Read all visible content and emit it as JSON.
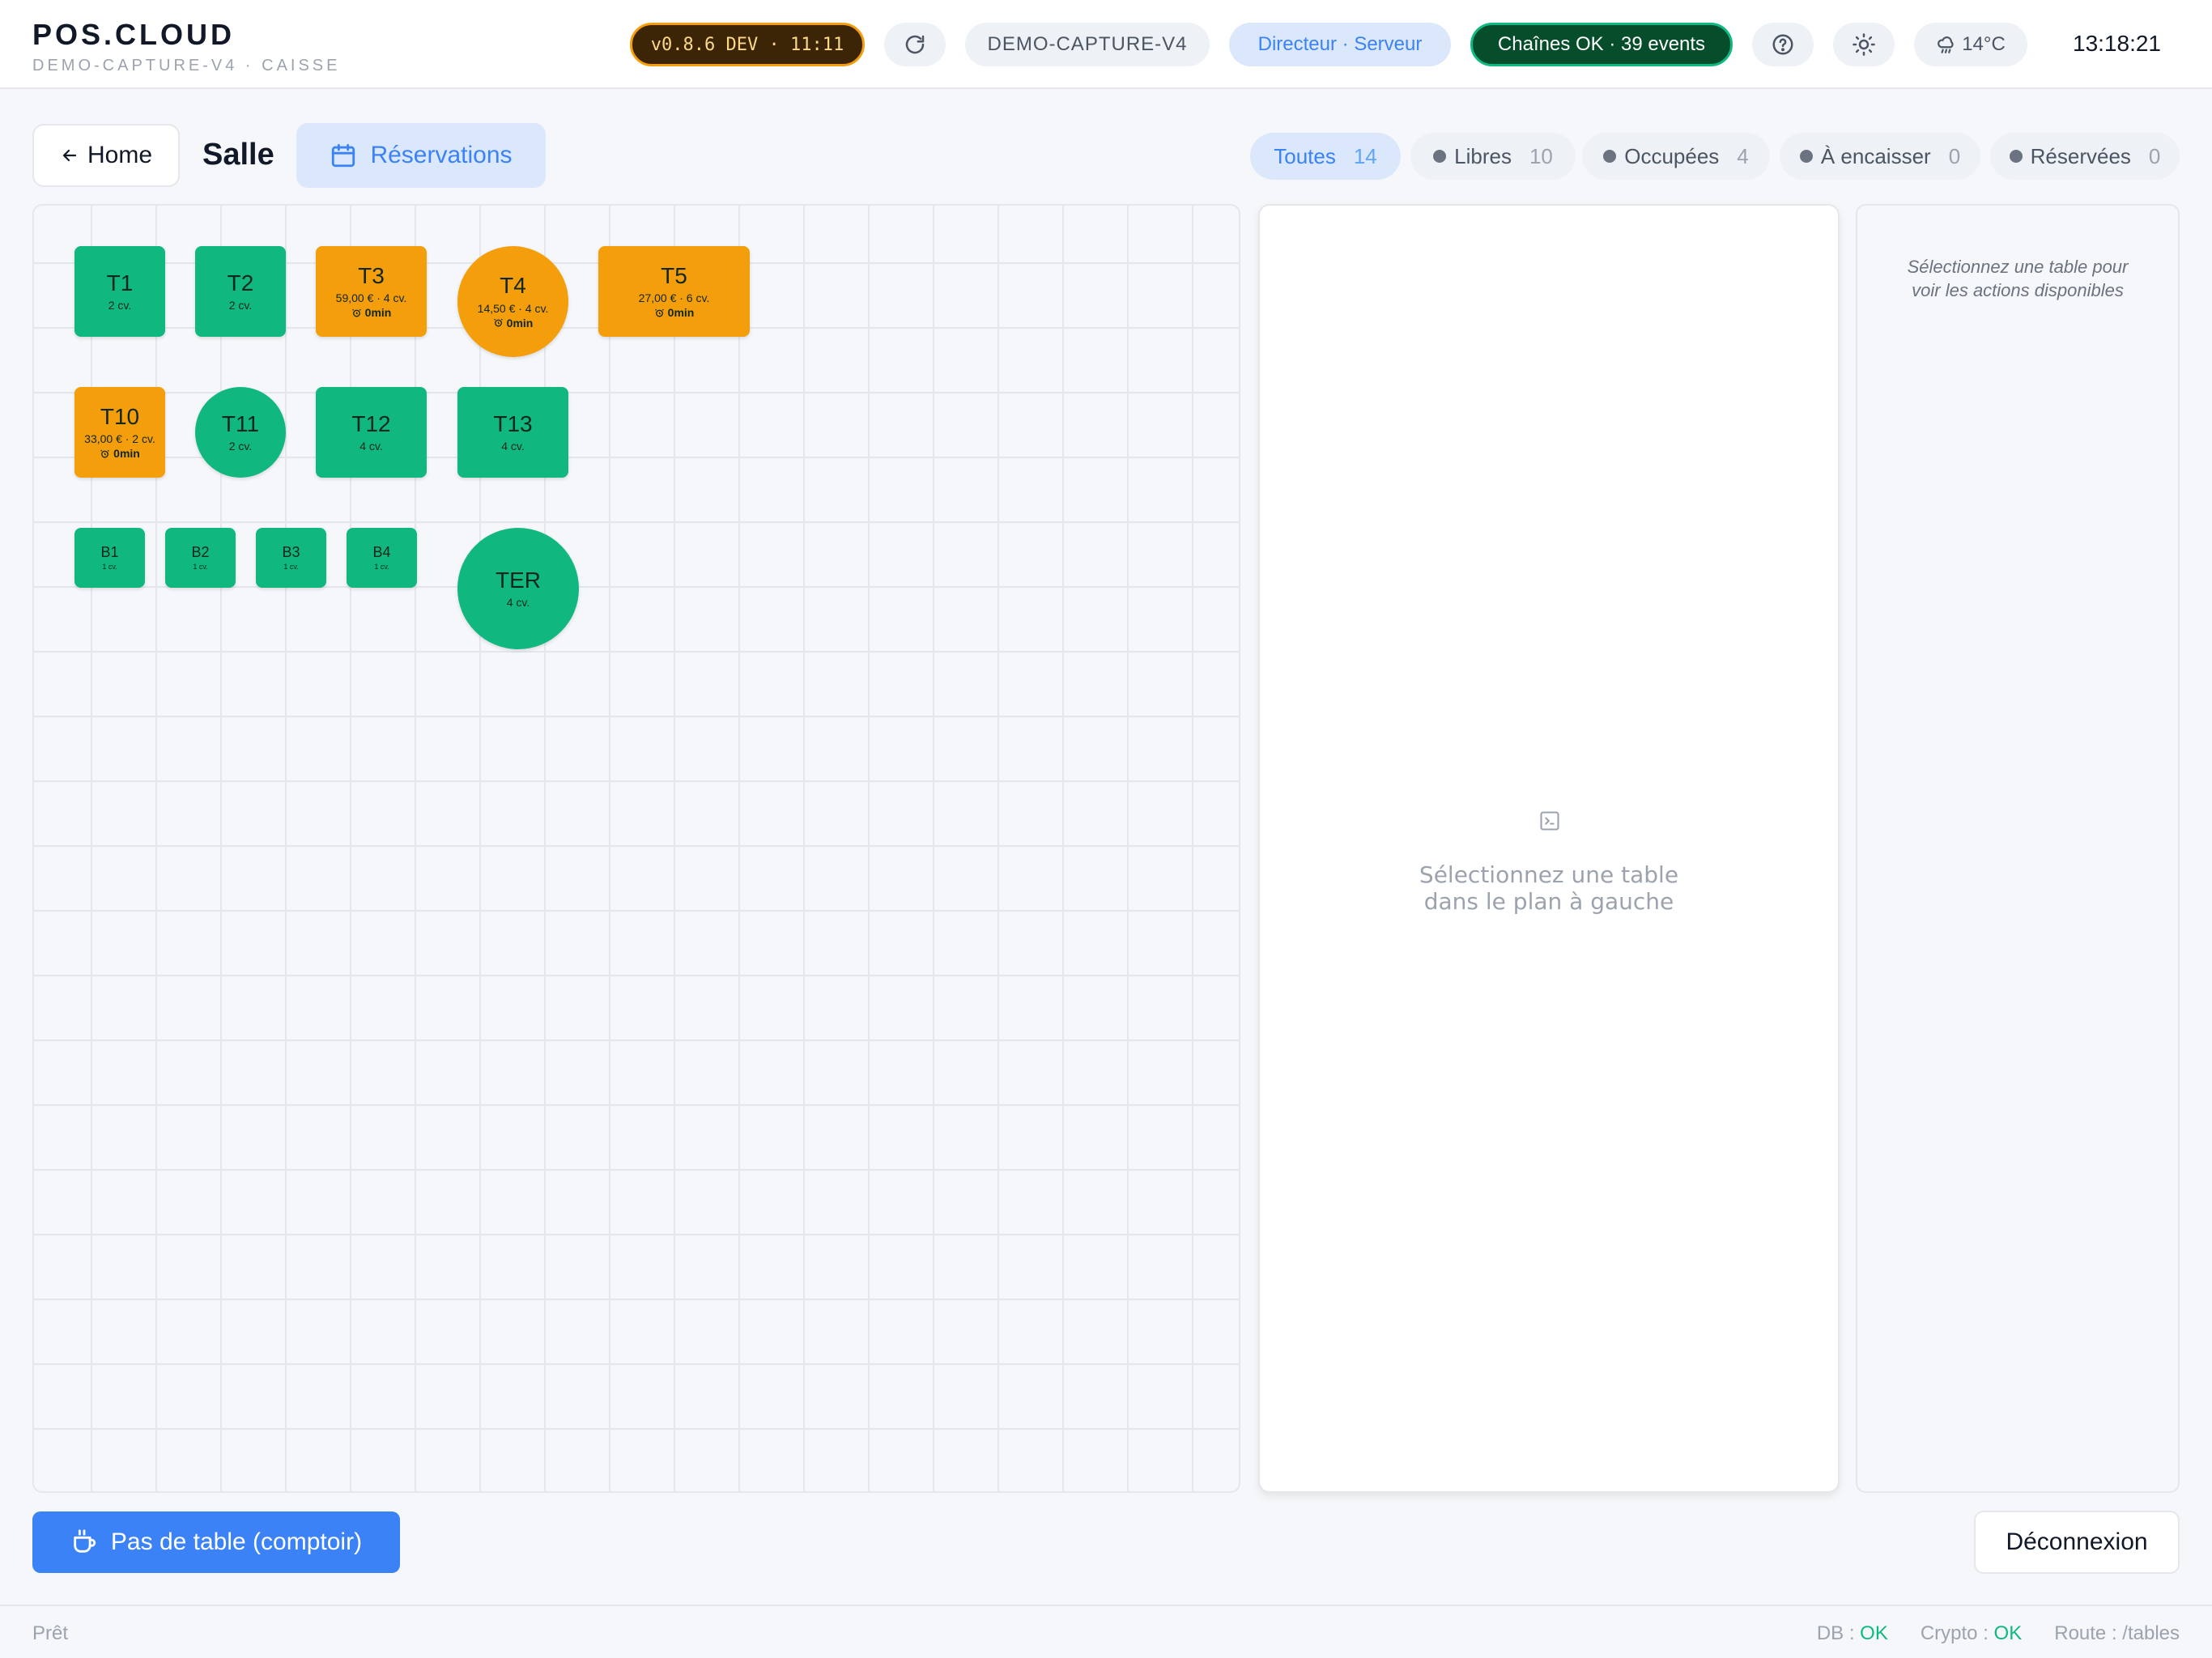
{
  "header": {
    "brand": "POS.CLOUD",
    "subtitle": "DEMO-CAPTURE-V4 · CAISSE",
    "version": "v0.8.6 DEV · 11:11",
    "device": "DEMO-CAPTURE-V4",
    "role": "Directeur · Serveur",
    "chains_status": "Chaînes OK · 39 events",
    "weather": "14°C",
    "clock": "13:18:21"
  },
  "toolbar": {
    "home_label": "Home",
    "section_title": "Salle",
    "reservations_label": "Réservations"
  },
  "filters": [
    {
      "label": "Toutes",
      "count": "14",
      "active": true
    },
    {
      "label": "Libres",
      "count": "10",
      "active": false
    },
    {
      "label": "Occupées",
      "count": "4",
      "active": false
    },
    {
      "label": "À encaisser",
      "count": "0",
      "active": false
    },
    {
      "label": "Réservées",
      "count": "0",
      "active": false
    }
  ],
  "tables": [
    {
      "name": "T1",
      "covers": "2 cv.",
      "status": "free"
    },
    {
      "name": "T2",
      "covers": "2 cv.",
      "status": "free"
    },
    {
      "name": "T3",
      "covers": "59,00 € · 4 cv.",
      "timer": "0min",
      "status": "busy"
    },
    {
      "name": "T4",
      "covers": "14,50 € · 4 cv.",
      "timer": "0min",
      "status": "busy"
    },
    {
      "name": "T5",
      "covers": "27,00 € · 6 cv.",
      "timer": "0min",
      "status": "busy"
    },
    {
      "name": "T10",
      "covers": "33,00 € · 2 cv.",
      "timer": "0min",
      "status": "busy"
    },
    {
      "name": "T11",
      "covers": "2 cv.",
      "status": "free"
    },
    {
      "name": "T12",
      "covers": "4 cv.",
      "status": "free"
    },
    {
      "name": "T13",
      "covers": "4 cv.",
      "status": "free"
    },
    {
      "name": "B1",
      "covers": "1 cv.",
      "status": "free"
    },
    {
      "name": "B2",
      "covers": "1 cv.",
      "status": "free"
    },
    {
      "name": "B3",
      "covers": "1 cv.",
      "status": "free"
    },
    {
      "name": "B4",
      "covers": "1 cv.",
      "status": "free"
    },
    {
      "name": "TER",
      "covers": "4 cv.",
      "status": "free"
    }
  ],
  "center_panel": {
    "line1": "Sélectionnez une table",
    "line2": "dans le plan à gauche"
  },
  "right_panel": {
    "line1": "Sélectionnez une table pour",
    "line2": "voir les actions disponibles"
  },
  "footer": {
    "counter_button": "Pas de table (comptoir)",
    "logout_button": "Déconnexion"
  },
  "statusbar": {
    "ready": "Prêt",
    "db_label": "DB : ",
    "db_value": "OK",
    "crypto_label": "Crypto : ",
    "crypto_value": "OK",
    "route": "Route : /tables"
  },
  "colors": {
    "free": "#10b77f",
    "busy": "#f59e0b",
    "accent": "#3b82f6",
    "ok": "#10b981"
  }
}
